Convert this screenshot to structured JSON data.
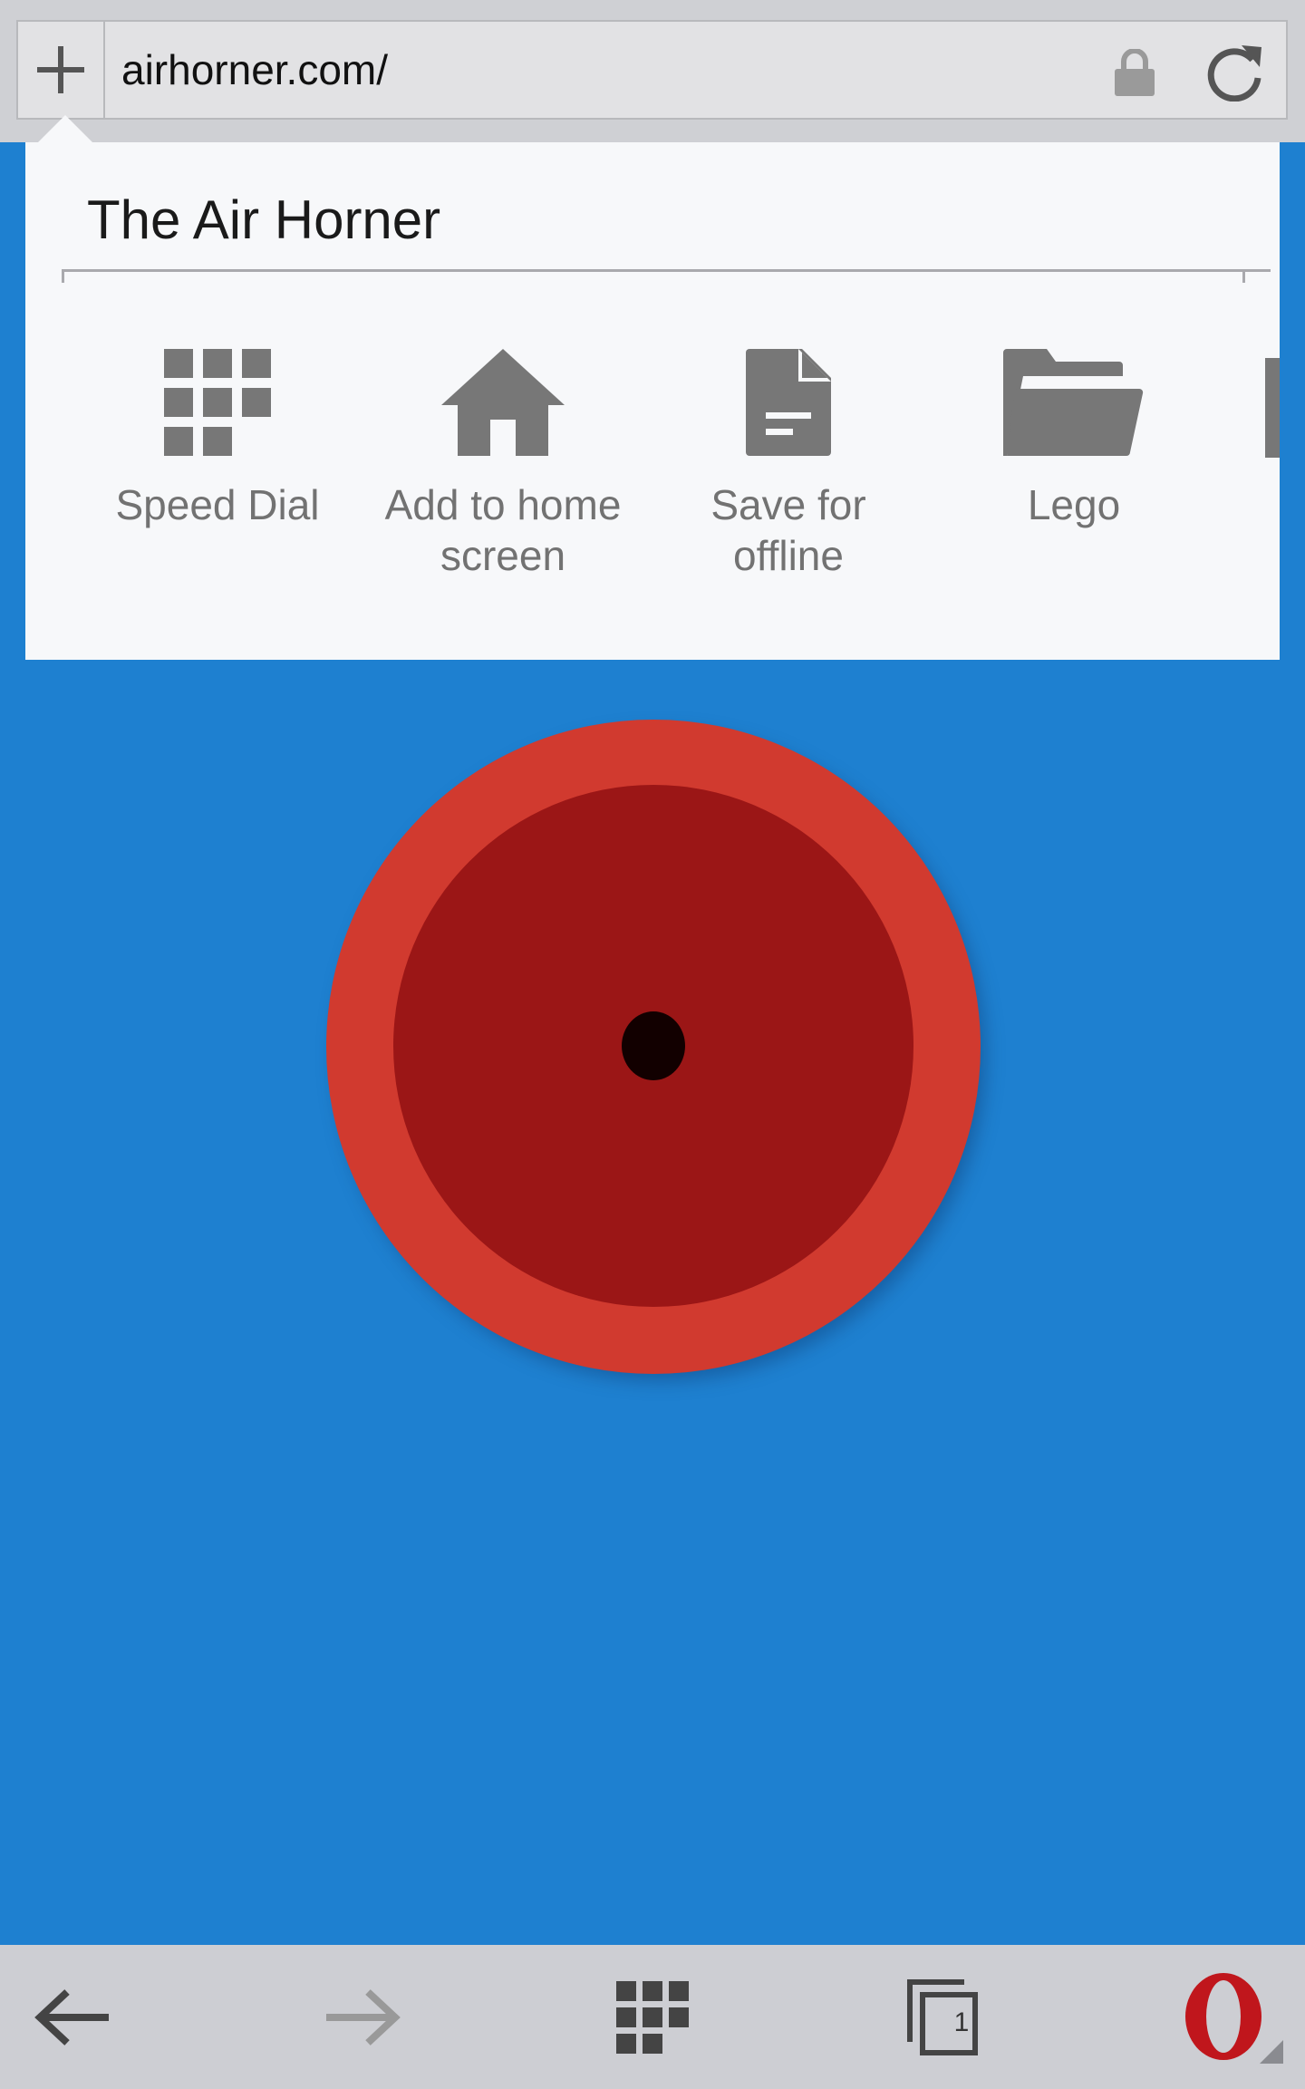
{
  "address_bar": {
    "url": "airhorner.com/",
    "plus_icon": "plus-icon",
    "lock_icon": "lock-icon",
    "reload_icon": "reload-icon"
  },
  "popup": {
    "title_value": "The Air Horner",
    "actions": [
      {
        "label": "Speed Dial",
        "icon": "speed-dial-grid-icon"
      },
      {
        "label": "Add to home screen",
        "icon": "home-icon"
      },
      {
        "label": "Save for offline",
        "icon": "document-icon"
      },
      {
        "label": "Lego",
        "icon": "folder-icon"
      }
    ]
  },
  "bottom_nav": {
    "back_icon": "back-arrow-icon",
    "forward_icon": "forward-arrow-icon",
    "speed_dial_icon": "speed-dial-grid-icon",
    "tabs_icon": "tabs-icon",
    "tab_count": "1",
    "menu_icon": "opera-logo-icon"
  },
  "colors": {
    "page_background": "#1e80d0",
    "horn_outer": "#d13a2f",
    "horn_inner": "#9b1616",
    "opera_red": "#c0161c"
  }
}
